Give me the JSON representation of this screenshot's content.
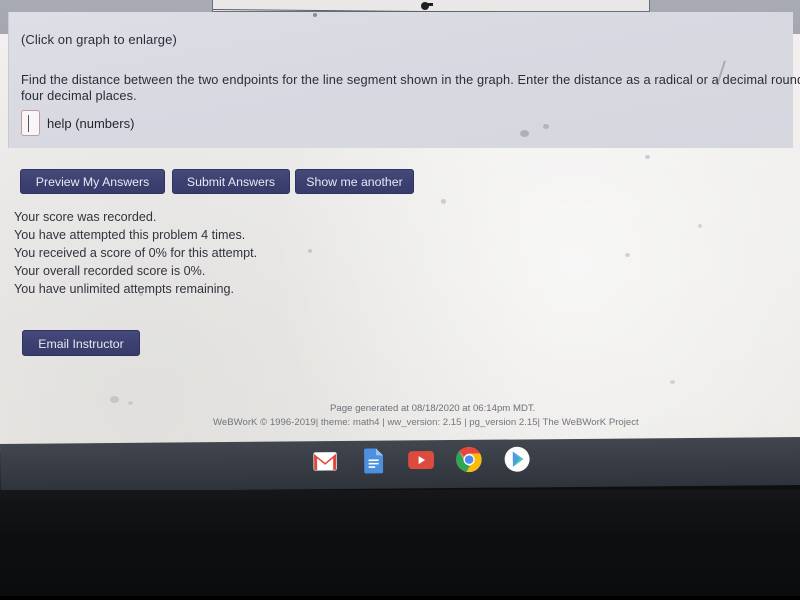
{
  "graph": {
    "caption": "(Click on graph to enlarge)",
    "endpoint_marker": "line-endpoint-dot"
  },
  "problem": {
    "line1": "Find the distance between the two endpoints for the line segment shown in the graph. Enter the distance as a radical or a decimal rounded to",
    "line2": "four decimal places.",
    "answer_value": "",
    "answer_placeholder": "",
    "help_label": "help (numbers)"
  },
  "buttons": {
    "preview": "Preview My Answers",
    "submit": "Submit Answers",
    "show_another": "Show me another",
    "email_instructor": "Email Instructor",
    "color": "#3c4070"
  },
  "status": {
    "lines": [
      "Your score was recorded.",
      "You have attempted this problem 4 times.",
      "You received a score of 0% for this attempt.",
      "Your overall recorded score is 0%.",
      "You have unlimited attempts remaining."
    ]
  },
  "footer": {
    "generated": "Page generated at 08/18/2020 at 06:14pm MDT.",
    "version": "WeBWorK © 1996-2019| theme: math4 | ww_version: 2.15 | pg_version 2.15| The WeBWorK Project"
  },
  "taskbar": {
    "icons": [
      {
        "name": "gmail-icon",
        "label": "Gmail"
      },
      {
        "name": "google-docs-icon",
        "label": "Docs"
      },
      {
        "name": "youtube-icon",
        "label": "YouTube"
      },
      {
        "name": "chrome-icon",
        "label": "Chrome"
      },
      {
        "name": "play-store-icon",
        "label": "Play Store"
      }
    ]
  }
}
